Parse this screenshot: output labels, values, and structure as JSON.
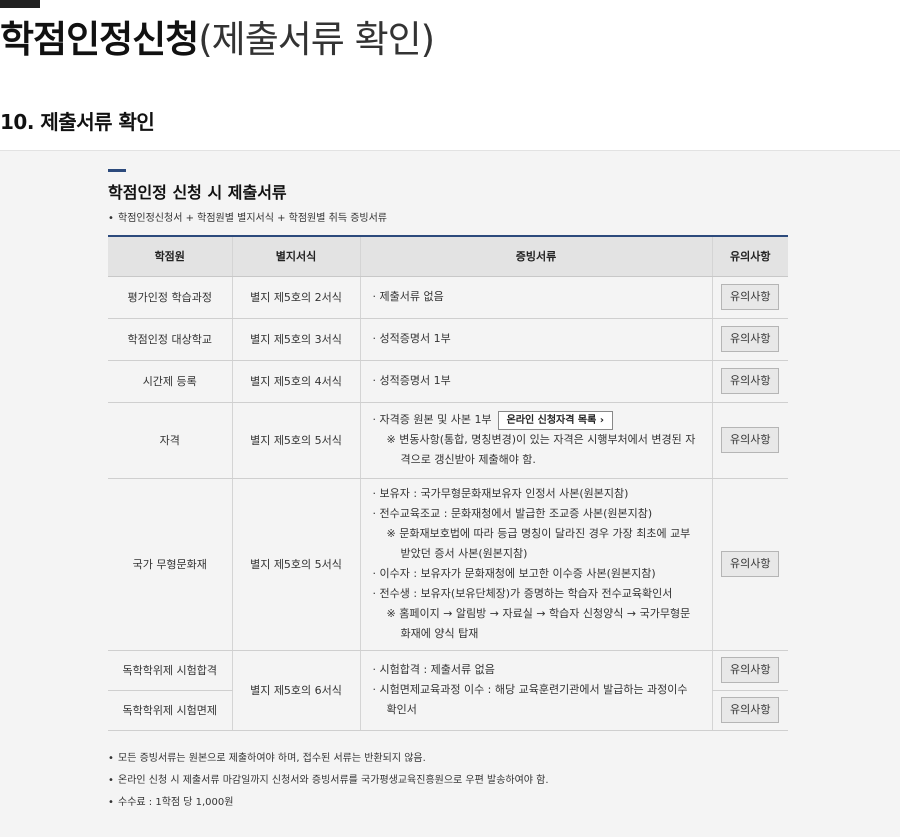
{
  "page": {
    "title_strong": "학점인정신청",
    "title_light": "(제출서류 확인)",
    "section_heading": "10. 제출서류 확인"
  },
  "box": {
    "title": "학점인정 신청 시 제출서류",
    "subtitle": "학점인정신청서 + 학점원별 별지서식 + 학점원별 취득 증빙서류"
  },
  "table": {
    "headers": [
      "학점원",
      "별지서식",
      "증빙서류",
      "유의사항"
    ],
    "note_label": "유의사항",
    "online_label": "온라인 신청자격 목록",
    "online_arrow": "›",
    "rows": [
      {
        "source": "평가인정 학습과정",
        "form": "별지 제5호의 2서식",
        "docs": [
          "· 제출서류 없음"
        ]
      },
      {
        "source": "학점인정 대상학교",
        "form": "별지 제5호의 3서식",
        "docs": [
          "· 성적증명서 1부"
        ]
      },
      {
        "source": "시간제 등록",
        "form": "별지 제5호의 4서식",
        "docs": [
          "· 성적증명서 1부"
        ]
      },
      {
        "source": "자격",
        "form": "별지 제5호의 5서식",
        "docs": [
          "· 자격증 원본 및 사본 1부",
          "※ 변동사항(통합, 명칭변경)이 있는 자격은 시행부처에서 변경된 자",
          "격으로 갱신받아 제출해야 함."
        ]
      },
      {
        "source": "국가 무형문화재",
        "form": "별지 제5호의 5서식",
        "docs": [
          "· 보유자 : 국가무형문화재보유자 인정서 사본(원본지참)",
          "· 전수교육조교 : 문화재청에서 발급한 조교증 사본(원본지참)",
          "※ 문화재보호법에 따라 등급 명칭이 달라진 경우 가장 최초에 교부",
          "받았던 증서 사본(원본지참)",
          "· 이수자 : 보유자가 문화재청에 보고한 이수증 사본(원본지참)",
          "· 전수생 : 보유자(보유단체장)가 증명하는 학습자 전수교육확인서",
          "※ 홈페이지 → 알림방 → 자료실 → 학습자 신청양식 → 국가무형문",
          "화재에 양식 탑재"
        ]
      },
      {
        "source": "독학학위제 시험합격",
        "form": "별지 제5호의 6서식",
        "docs": [
          "· 시험합격 : 제출서류 없음",
          "· 시험면제교육과정 이수 : 해당 교육훈련기관에서 발급하는 과정이수",
          "확인서"
        ]
      },
      {
        "source": "독학학위제 시험면제"
      }
    ]
  },
  "footnotes": [
    "모든 증빙서류는 원본으로 제출하여야 하며, 접수된 서류는 반환되지 않음.",
    "온라인 신청 시 제출서류 마감일까지 신청서와 증빙서류를 국가평생교육진흥원으로 우편 발송하여야 함.",
    "수수료 : 1학점 당 1,000원"
  ],
  "bullet": "•",
  "colors": {
    "accent": "#2c4a7c",
    "panel": "#f4f4f4",
    "header": "#e3e3e3"
  }
}
